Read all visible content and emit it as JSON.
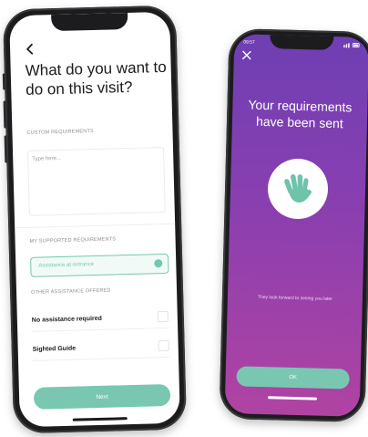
{
  "left_screen": {
    "title": "What do you want to do on this visit?",
    "custom_requirements_label": "CUSTOM REQUIREMENTS",
    "custom_requirements_placeholder": "Type here...",
    "supported_requirements_label": "MY SUPPORTED REQUIREMENTS",
    "supported_requirement": "Assistance at entrance",
    "other_assistance_label": "OTHER ASSISTANCE OFFERED",
    "options": [
      {
        "label": "No assistance required"
      },
      {
        "label": "Sighted Guide"
      }
    ],
    "next_button": "Next"
  },
  "right_screen": {
    "status_time": "09:57",
    "title": "Your requirements have been sent",
    "subtitle": "They look forward to seeing you later",
    "ok_button": "OK"
  },
  "colors": {
    "accent": "#79c7b1",
    "gradient_top": "#6e3fb3",
    "gradient_bottom": "#b043a2",
    "phone_frame": "#1c1c1e"
  },
  "icons": [
    "back-chevron-icon",
    "close-icon",
    "waving-hand-icon",
    "selected-dot-icon",
    "checkbox-icon"
  ]
}
